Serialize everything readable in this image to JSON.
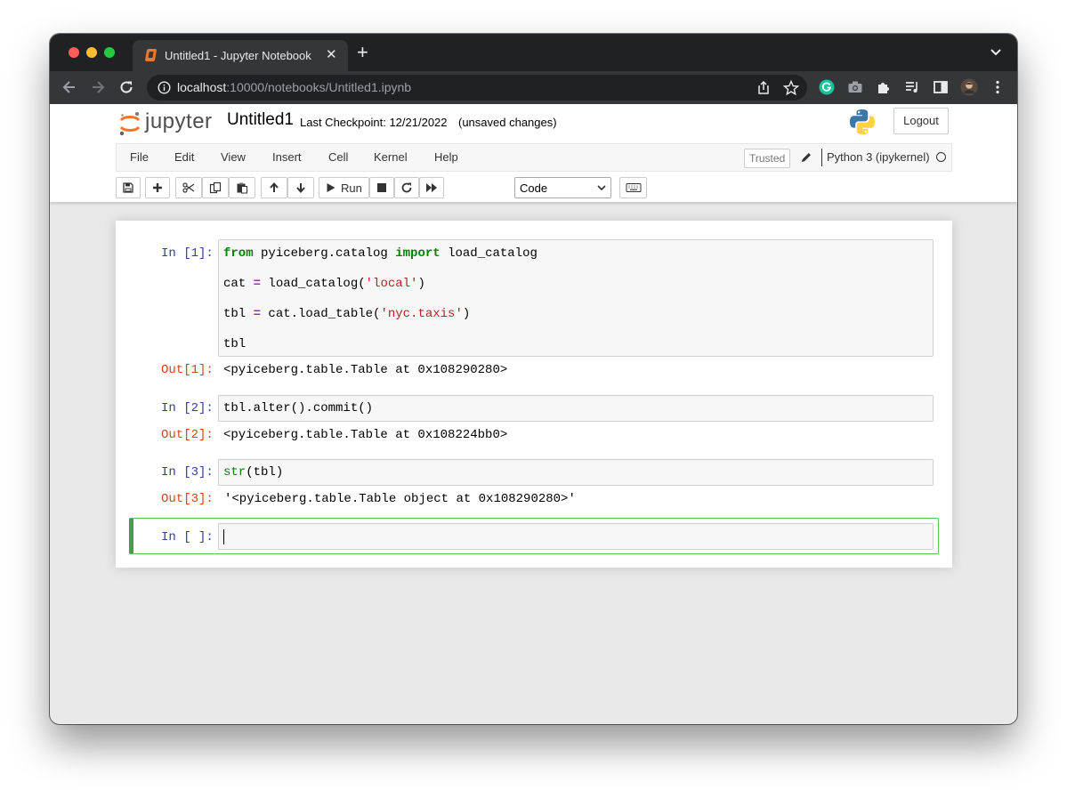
{
  "browser": {
    "tab_title": "Untitled1 - Jupyter Notebook",
    "url_host": "localhost",
    "url_path": ":10000/notebooks/Untitled1.ipynb"
  },
  "header": {
    "logo_text": "jupyter",
    "notebook_title": "Untitled1",
    "checkpoint": "Last Checkpoint: 12/21/2022",
    "checkpoint_status": "(unsaved changes)",
    "logout_label": "Logout"
  },
  "menubar": {
    "items": [
      "File",
      "Edit",
      "View",
      "Insert",
      "Cell",
      "Kernel",
      "Help"
    ],
    "trusted_label": "Trusted",
    "kernel_name": "Python 3 (ipykernel)"
  },
  "toolbar": {
    "run_label": "Run",
    "cell_type": "Code"
  },
  "cells": [
    {
      "in_prompt": "In [1]:",
      "code": [
        [
          {
            "t": "kw",
            "v": "from"
          },
          {
            "t": "n",
            "v": " pyiceberg.catalog "
          },
          {
            "t": "kw",
            "v": "import"
          },
          {
            "t": "n",
            "v": " load_catalog"
          }
        ],
        [
          {
            "t": "n",
            "v": "cat "
          },
          {
            "t": "op",
            "v": "="
          },
          {
            "t": "n",
            "v": " load_catalog("
          },
          {
            "t": "str",
            "v": "'local'"
          },
          {
            "t": "n",
            "v": ")"
          }
        ],
        [
          {
            "t": "n",
            "v": "tbl "
          },
          {
            "t": "op",
            "v": "="
          },
          {
            "t": "n",
            "v": " cat.load_table("
          },
          {
            "t": "str",
            "v": "'nyc.taxis'"
          },
          {
            "t": "n",
            "v": ")"
          }
        ],
        [
          {
            "t": "n",
            "v": "tbl"
          }
        ]
      ],
      "out_prompt": "Out[1]:",
      "output": "<pyiceberg.table.Table at 0x108290280>"
    },
    {
      "in_prompt": "In [2]:",
      "code": [
        [
          {
            "t": "n",
            "v": "tbl.alter().commit()"
          }
        ]
      ],
      "out_prompt": "Out[2]:",
      "output": "<pyiceberg.table.Table at 0x108224bb0>"
    },
    {
      "in_prompt": "In [3]:",
      "code": [
        [
          {
            "t": "bi",
            "v": "str"
          },
          {
            "t": "n",
            "v": "(tbl)"
          }
        ]
      ],
      "out_prompt": "Out[3]:",
      "output": "'<pyiceberg.table.Table object at 0x108290280>'"
    }
  ],
  "empty_cell": {
    "in_prompt": "In [ ]:"
  },
  "colors": {
    "in_prompt": "#303f9f",
    "out_prompt": "#d84315",
    "keyword": "#008000",
    "string": "#ba2121",
    "operator": "#aa22ff",
    "active_border": "#42a047"
  }
}
